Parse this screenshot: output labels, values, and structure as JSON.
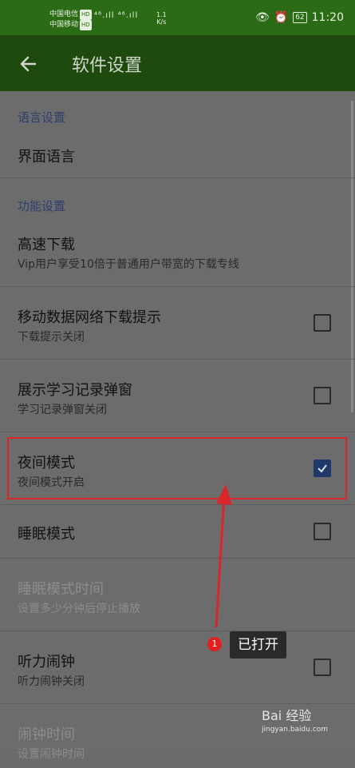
{
  "status_bar": {
    "carrier1": "中国电信",
    "carrier2": "中国移动",
    "hd": "HD",
    "signal": "⁴⁶.ıll ⁴⁶.ıll",
    "speed_value": "1.1",
    "speed_unit": "K/s",
    "battery": "62",
    "time": "11:20"
  },
  "app_bar": {
    "title": "软件设置"
  },
  "sections": [
    {
      "header": "语言设置"
    },
    {
      "header": "功能设置"
    }
  ],
  "rows": [
    {
      "title": "界面语言"
    },
    {
      "title": "高速下载",
      "subtitle": "Vip用户享受10倍于普通用户带宽的下载专线"
    },
    {
      "title": "移动数据网络下载提示",
      "subtitle": "下载提示关闭",
      "checked": false
    },
    {
      "title": "展示学习记录弹窗",
      "subtitle": "学习记录弹窗关闭",
      "checked": false
    },
    {
      "title": "夜间模式",
      "subtitle": "夜间模式开启",
      "checked": true
    },
    {
      "title": "睡眠模式",
      "checked": false
    },
    {
      "title": "睡眠模式时间",
      "subtitle": "设置多少分钟后停止播放",
      "disabled": true
    },
    {
      "title": "听力闹钟",
      "subtitle": "听力闹钟关闭",
      "checked": false
    },
    {
      "title": "闹钟时间",
      "subtitle": "设置闹钟时间",
      "disabled": true
    }
  ],
  "annotation": {
    "badge": "1",
    "text": "已打开"
  },
  "watermark": {
    "brand": "Bai  经验",
    "url": "jingyan.baidu.com"
  },
  "colors": {
    "status_bar": "#2c6b16",
    "app_bar": "#1e4a0e",
    "highlight": "#d8262b",
    "accent": "#1f3a6a"
  }
}
